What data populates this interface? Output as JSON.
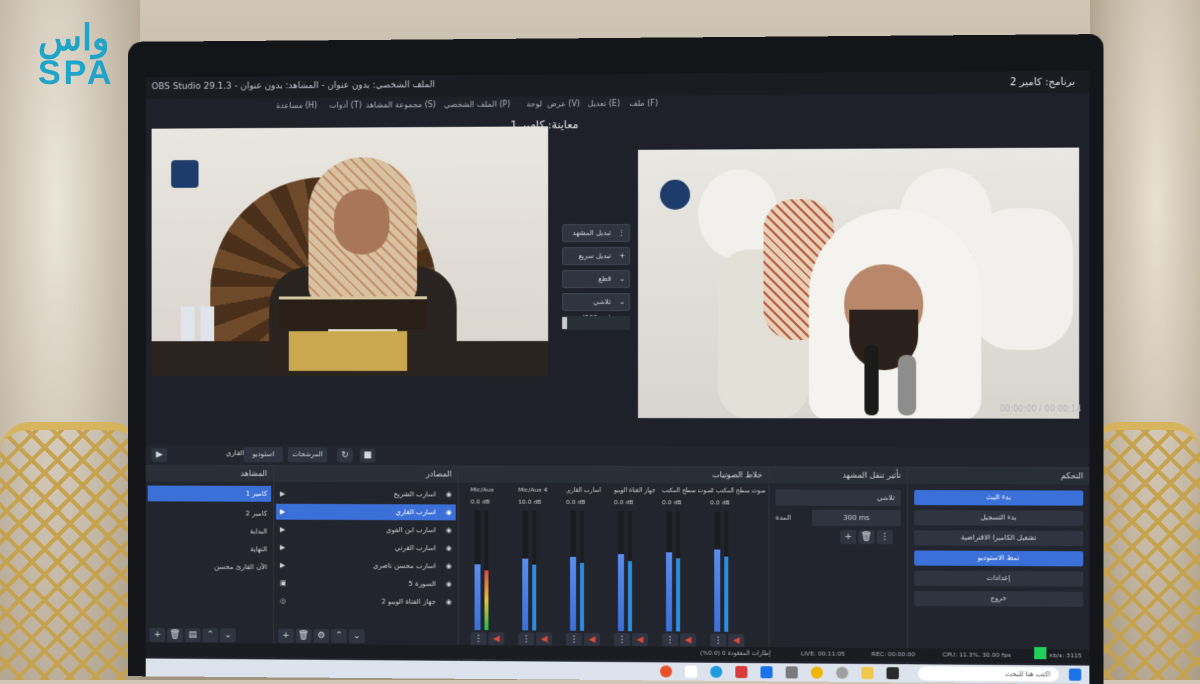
{
  "logo": {
    "arabic": "واس",
    "english": "SPA"
  },
  "obs": {
    "app_title": "OBS Studio 29.1.3 - الملف الشخصي: بدون عنوان - المشاهد: بدون عنوان",
    "program_label": "برنامج: كامير 2",
    "preview_label": "معاينة: كامير 1",
    "menu": [
      "ملف (F)",
      "تعديل (E)",
      "عرض (V)",
      "لوحة",
      "الملف الشخصي (P)",
      "مجموعة المشاهد (S)",
      "أدوات (T)",
      "مساعدة (H)"
    ],
    "timecode": "00:00:00 / 00:00:14",
    "transitions": {
      "buttons": [
        {
          "label": "تبديل المشهد",
          "icon": "⋮"
        },
        {
          "label": "تبديل سريع",
          "icon": "+"
        },
        {
          "label": "قطع",
          "icon": "⌄"
        },
        {
          "label": "تلاشي (300ms)",
          "icon": "⌄"
        }
      ]
    },
    "scene_controls": {
      "studio_mode": "استوديو",
      "filters": "المرشحات",
      "scene_name": "اسارب القاري"
    },
    "scenes": {
      "header": "المشاهد",
      "items": [
        "كامير 1",
        "كامير 2",
        "البداية",
        "النهاية",
        "الآن القارئ محسن"
      ],
      "selected": 0
    },
    "sources": {
      "header": "المصادر",
      "items": [
        "اسارب الشريخ",
        "اسارب القاري",
        "اسارب ابن الفوي",
        "اسارب القرني",
        "اسارب محسن ناصري",
        "السورة 5",
        "جهاز الفتاة الويبو 2"
      ],
      "selected": 1
    },
    "mixer": {
      "header": "خلاط الصوتيات",
      "channels": [
        {
          "name": "Mic/Aux",
          "db": "0.0 dB",
          "level": 0.55
        },
        {
          "name": "Mic/Aux 4",
          "db": "10.0 dB",
          "level": 0.6
        },
        {
          "name": "اسارب القاري",
          "db": "0.0 dB",
          "level": 0.62
        },
        {
          "name": "جهاز الفتاة الويبو",
          "db": "0.0 dB",
          "level": 0.64
        },
        {
          "name": "صوت سطح المكتب",
          "db": "0.0 dB",
          "level": 0.66
        },
        {
          "name": "صوت سطح المكتب 2",
          "db": "0.0 dB",
          "level": 0.68
        }
      ]
    },
    "scene_transitions": {
      "header": "تأثير تنقل المشهد",
      "type": "تلاشي",
      "duration_label": "المدة",
      "duration": "300 ms"
    },
    "controls": {
      "header": "التحكم",
      "buttons": [
        "بدء البث",
        "بدء التسجيل",
        "تشغيل الكاميرا الافتراضية",
        "نمط الاستوديو",
        "إعدادات",
        "خروج"
      ],
      "active": [
        0,
        3
      ]
    },
    "status": {
      "live": "LIVE: 00:11:05",
      "rec": "REC: 00:00:00",
      "cpu": "CPU: 11.3%, 30.00 fps",
      "kbps": "kb/s: 3115",
      "dropped": "إطارات المفقودة 0 (0.0%)"
    },
    "taskbar": {
      "search_placeholder": "اكتب هنا للبحث"
    }
  },
  "colors": {
    "accent": "#3b70d8",
    "obs_bg": "#1e2129",
    "logo": "#1fa5c9",
    "live": "#1fd15a"
  }
}
